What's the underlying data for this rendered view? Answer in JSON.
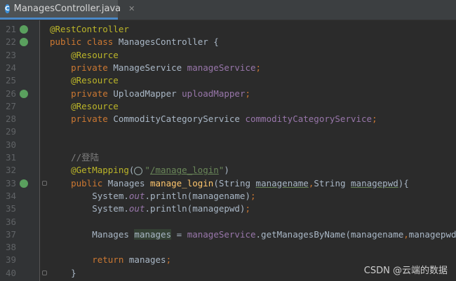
{
  "tab": {
    "icon": "C",
    "title": "ManagesController.java",
    "close": "✕"
  },
  "lines": [
    {
      "n": "21",
      "parts": [
        {
          "t": "@RestController",
          "c": "ann"
        }
      ]
    },
    {
      "n": "22",
      "parts": [
        {
          "t": "public class ",
          "c": "kw"
        },
        {
          "t": "ManagesController {",
          "c": ""
        }
      ]
    },
    {
      "n": "23",
      "parts": [
        {
          "t": "    @Resource",
          "c": "ann"
        }
      ]
    },
    {
      "n": "24",
      "parts": [
        {
          "t": "    private ",
          "c": "kw"
        },
        {
          "t": "ManageService ",
          "c": ""
        },
        {
          "t": "manageService",
          "c": "fld"
        },
        {
          "t": ";",
          "c": "kw"
        }
      ]
    },
    {
      "n": "25",
      "parts": [
        {
          "t": "    @Resource",
          "c": "ann"
        }
      ]
    },
    {
      "n": "26",
      "parts": [
        {
          "t": "    private ",
          "c": "kw"
        },
        {
          "t": "UploadMapper ",
          "c": ""
        },
        {
          "t": "uploadMapper",
          "c": "fld"
        },
        {
          "t": ";",
          "c": "kw"
        }
      ]
    },
    {
      "n": "27",
      "parts": [
        {
          "t": "    @Resource",
          "c": "ann"
        }
      ]
    },
    {
      "n": "28",
      "parts": [
        {
          "t": "    private ",
          "c": "kw"
        },
        {
          "t": "CommodityCategoryService ",
          "c": ""
        },
        {
          "t": "commodityCategoryService",
          "c": "fld"
        },
        {
          "t": ";",
          "c": "kw"
        }
      ]
    },
    {
      "n": "29",
      "parts": []
    },
    {
      "n": "30",
      "parts": []
    },
    {
      "n": "31",
      "parts": [
        {
          "t": "    //登陆",
          "c": "cmt"
        }
      ]
    },
    {
      "n": "32",
      "parts": [
        {
          "t": "    @GetMapping",
          "c": "ann"
        },
        {
          "t": "(",
          "c": ""
        },
        {
          "t": "",
          "c": "globe"
        },
        {
          "t": "\"",
          "c": "str"
        },
        {
          "t": "/manage_login",
          "c": "url"
        },
        {
          "t": "\"",
          "c": "str"
        },
        {
          "t": ")",
          "c": ""
        }
      ]
    },
    {
      "n": "33",
      "parts": [
        {
          "t": "    public ",
          "c": "kw"
        },
        {
          "t": "Manages ",
          "c": ""
        },
        {
          "t": "manage_login",
          "c": "fn"
        },
        {
          "t": "(String ",
          "c": ""
        },
        {
          "t": "managename",
          "c": "param"
        },
        {
          "t": ",",
          "c": "kw"
        },
        {
          "t": "String ",
          "c": ""
        },
        {
          "t": "managepwd",
          "c": "param"
        },
        {
          "t": "){",
          "c": ""
        }
      ]
    },
    {
      "n": "34",
      "parts": [
        {
          "t": "        System.",
          "c": ""
        },
        {
          "t": "out",
          "c": "fld it"
        },
        {
          "t": ".println(managename)",
          "c": ""
        },
        {
          "t": ";",
          "c": "kw"
        }
      ]
    },
    {
      "n": "35",
      "parts": [
        {
          "t": "        System.",
          "c": ""
        },
        {
          "t": "out",
          "c": "fld it"
        },
        {
          "t": ".println(managepwd)",
          "c": ""
        },
        {
          "t": ";",
          "c": "kw"
        }
      ]
    },
    {
      "n": "36",
      "parts": []
    },
    {
      "n": "37",
      "parts": [
        {
          "t": "        Manages ",
          "c": ""
        },
        {
          "t": "manages",
          "c": "hl"
        },
        {
          "t": " = ",
          "c": ""
        },
        {
          "t": "manageService",
          "c": "fld"
        },
        {
          "t": ".getManagesByName(managename",
          "c": ""
        },
        {
          "t": ",",
          "c": "kw"
        },
        {
          "t": "managepwd)",
          "c": ""
        },
        {
          "t": ";",
          "c": "kw"
        }
      ]
    },
    {
      "n": "38",
      "parts": []
    },
    {
      "n": "39",
      "parts": [
        {
          "t": "        return ",
          "c": "kw"
        },
        {
          "t": "manages",
          "c": ""
        },
        {
          "t": ";",
          "c": "kw"
        }
      ]
    },
    {
      "n": "40",
      "parts": [
        {
          "t": "    }",
          "c": ""
        }
      ]
    }
  ],
  "watermark": "CSDN @云端的数据"
}
